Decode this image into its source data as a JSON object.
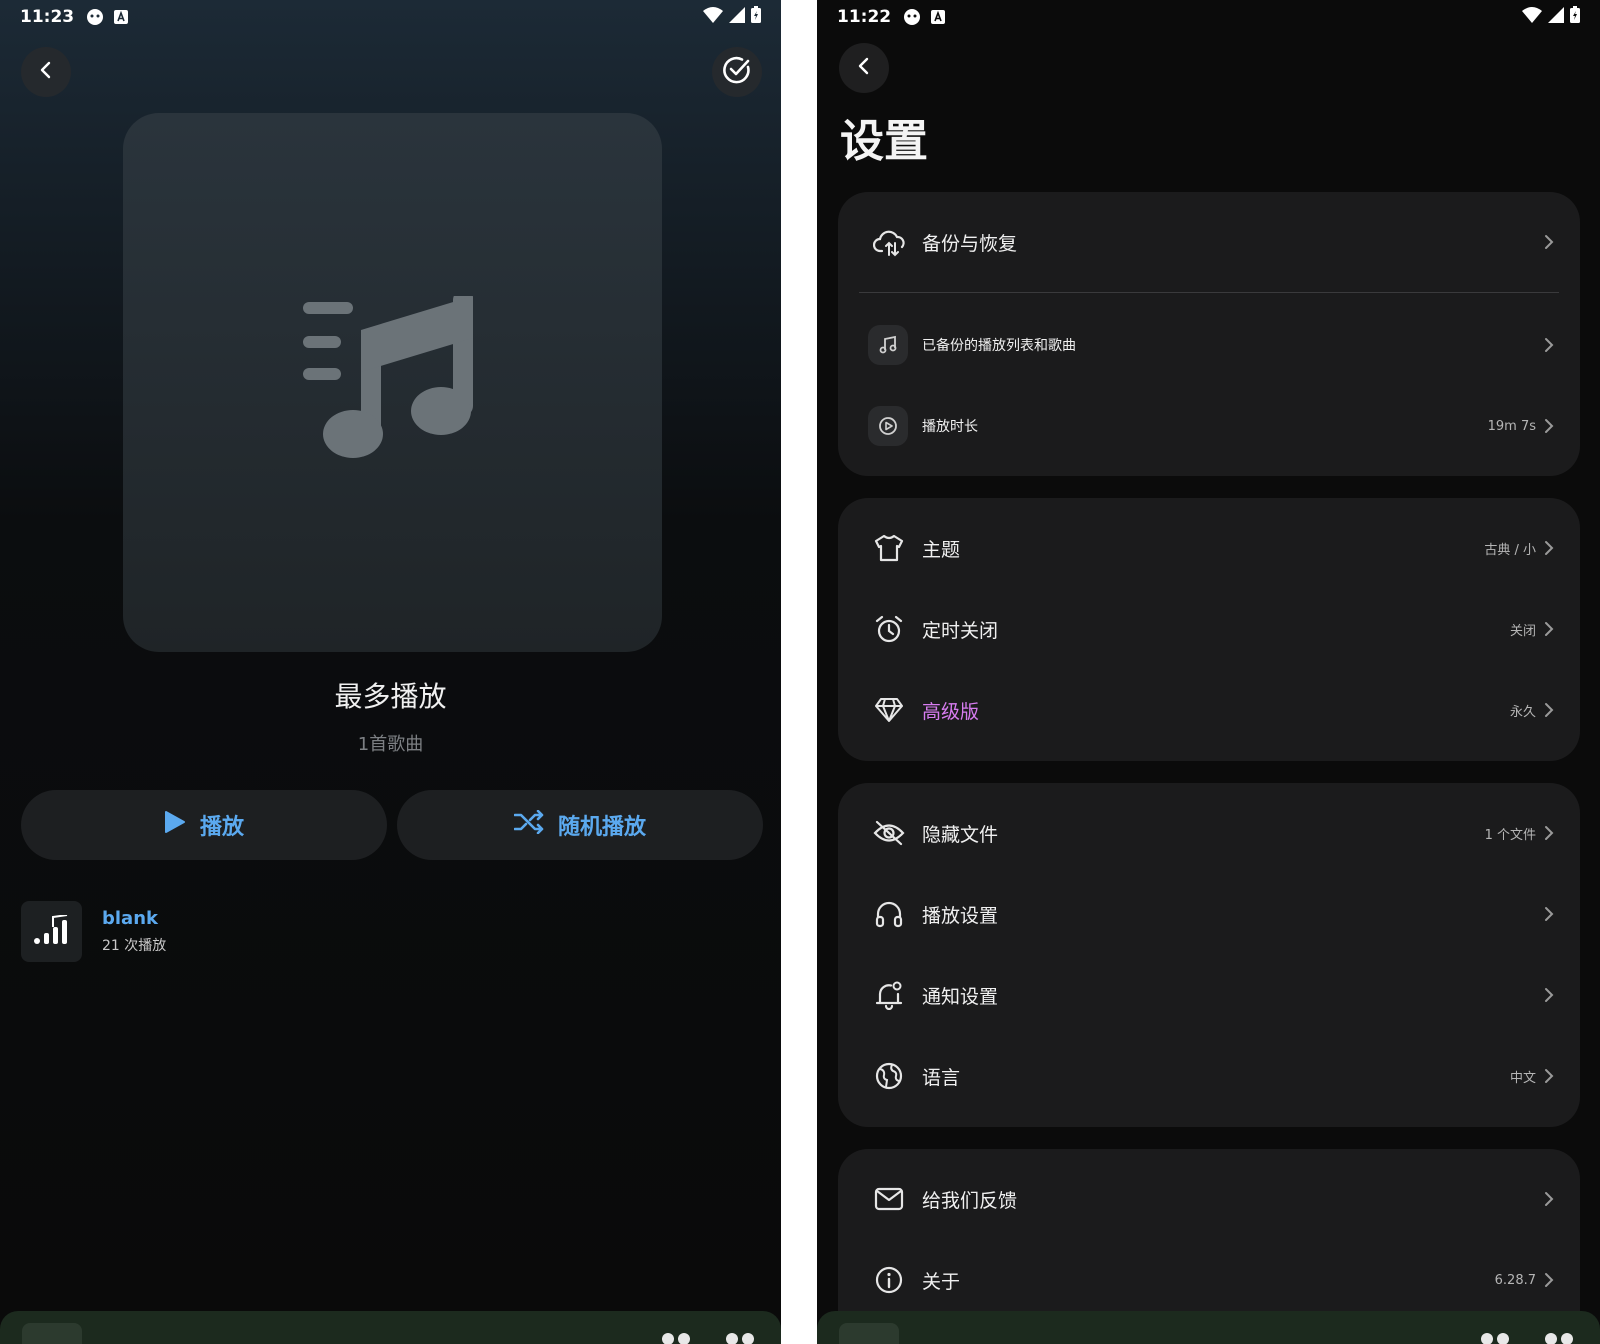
{
  "left": {
    "status": {
      "time": "11:23"
    },
    "playlist": {
      "title": "最多播放",
      "subtitle": "1首歌曲"
    },
    "buttons": {
      "play": "播放",
      "shuffle": "随机播放"
    },
    "song": {
      "name": "blank",
      "plays": "21 次播放"
    }
  },
  "right": {
    "status": {
      "time": "11:22"
    },
    "title": "设置",
    "group1": {
      "backup": {
        "label": "备份与恢复"
      },
      "backed_up": {
        "label": "已备份的播放列表和歌曲"
      },
      "play_time": {
        "label": "播放时长",
        "value": "19m 7s"
      }
    },
    "group2": {
      "theme": {
        "label": "主题",
        "value": "古典 / 小"
      },
      "sleep_timer": {
        "label": "定时关闭",
        "value": "关闭"
      },
      "premium": {
        "label": "高级版",
        "value": "永久"
      }
    },
    "group3": {
      "hidden_files": {
        "label": "隐藏文件",
        "value": "1 个文件"
      },
      "playback": {
        "label": "播放设置"
      },
      "notification": {
        "label": "通知设置"
      },
      "language": {
        "label": "语言",
        "value": "中文"
      }
    },
    "group4": {
      "feedback": {
        "label": "给我们反馈"
      },
      "about": {
        "label": "关于",
        "value": "6.28.7"
      }
    }
  },
  "colors": {
    "accent_blue": "#5ba9ef",
    "premium_purple": "#d77cf0"
  }
}
